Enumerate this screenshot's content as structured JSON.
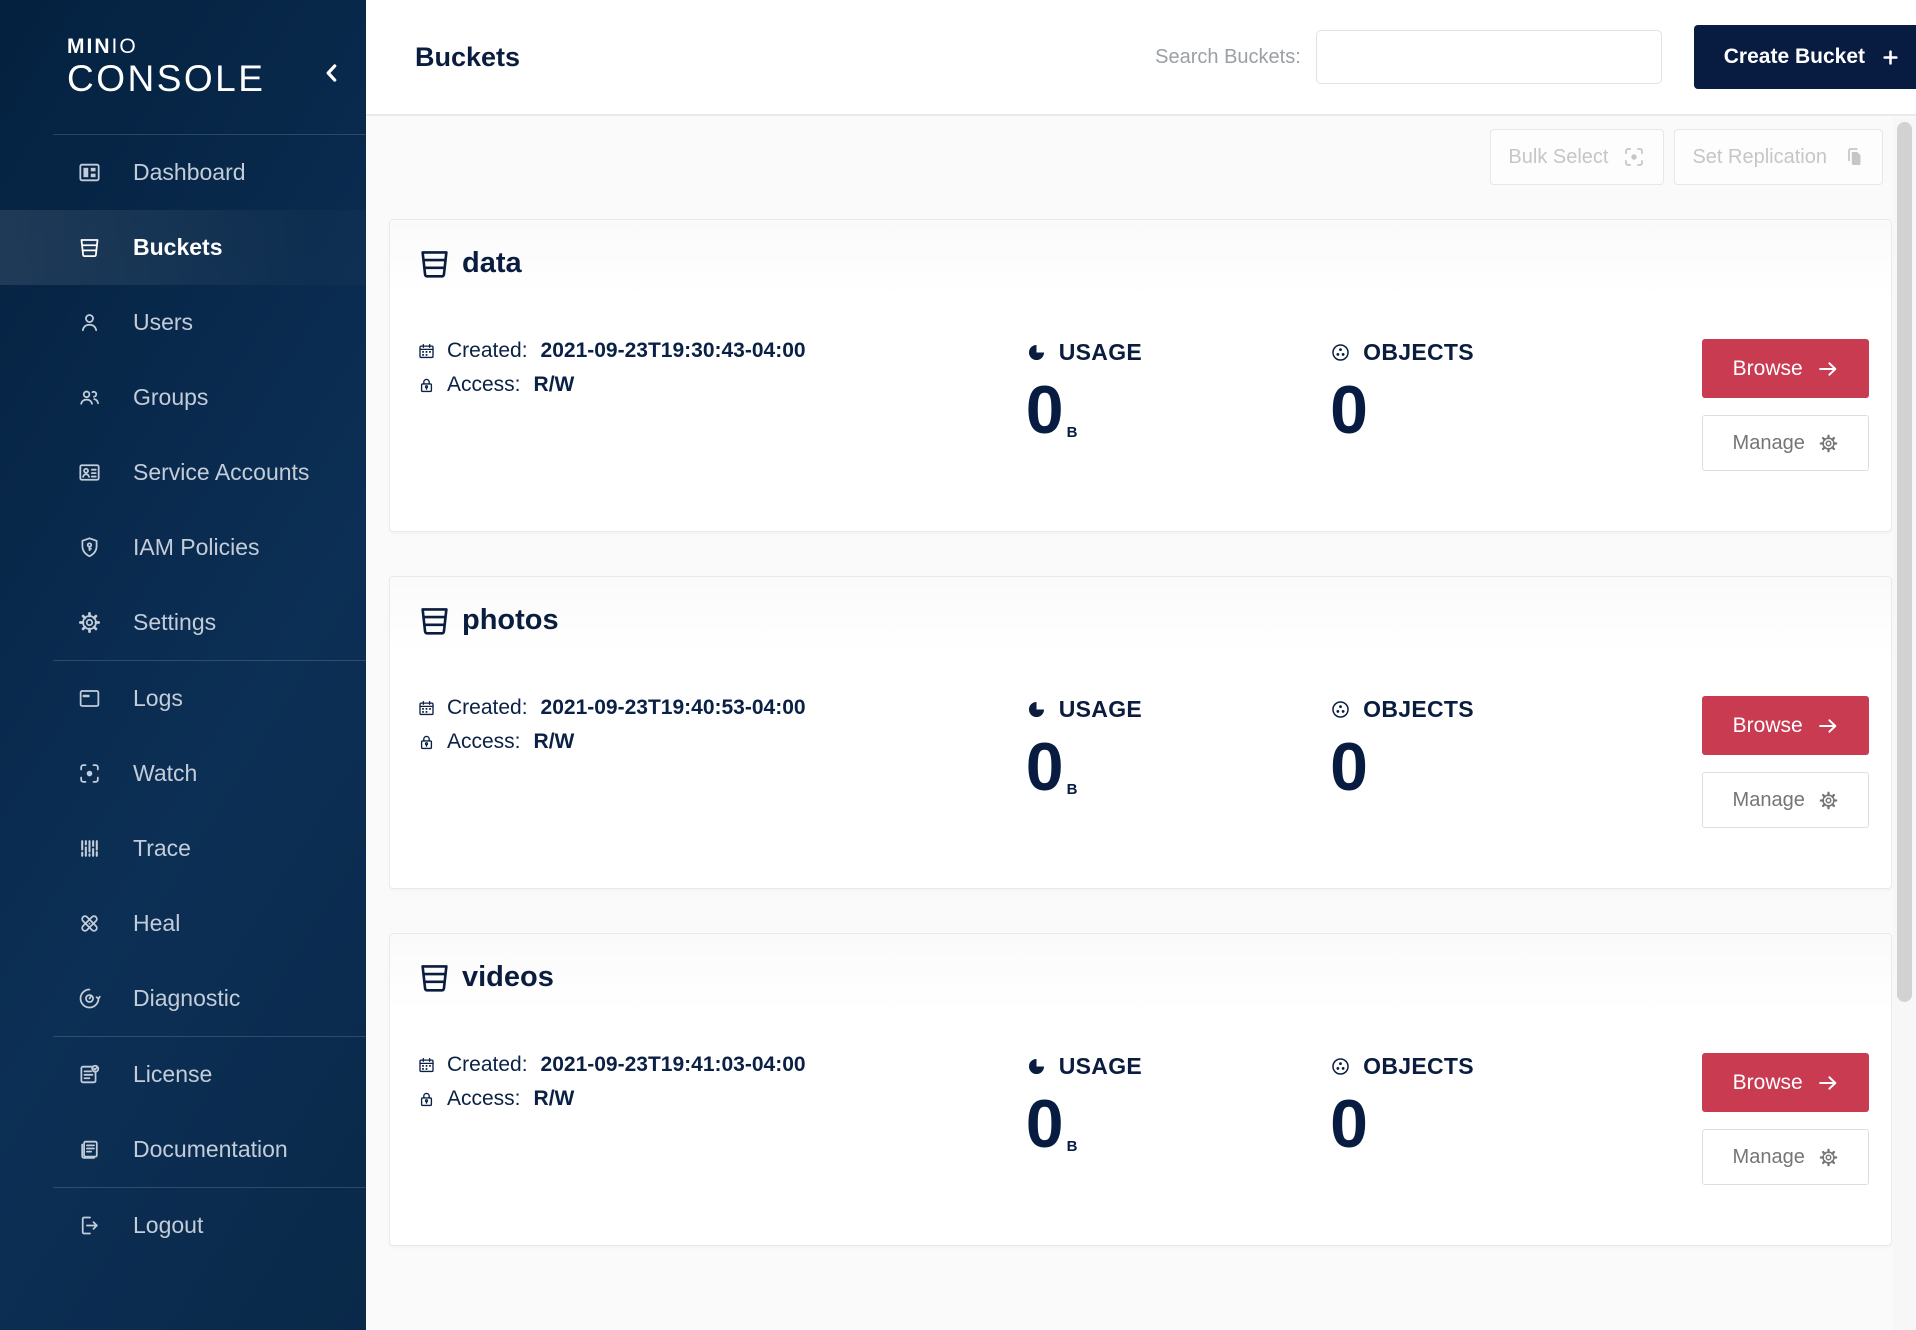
{
  "app": {
    "logo_bold": "MIN",
    "logo_light": "IO",
    "logo_line2": "CONSOLE"
  },
  "sidebar": {
    "collapse_icon": "chevron-left-icon",
    "items": [
      {
        "label": "Dashboard",
        "icon": "dashboard-icon",
        "active": false,
        "divider_before": true
      },
      {
        "label": "Buckets",
        "icon": "buckets-icon",
        "active": true,
        "divider_before": false
      },
      {
        "label": "Users",
        "icon": "users-icon",
        "active": false,
        "divider_before": false
      },
      {
        "label": "Groups",
        "icon": "groups-icon",
        "active": false,
        "divider_before": false
      },
      {
        "label": "Service Accounts",
        "icon": "service-accounts-icon",
        "active": false,
        "divider_before": false
      },
      {
        "label": "IAM Policies",
        "icon": "iam-policies-icon",
        "active": false,
        "divider_before": false
      },
      {
        "label": "Settings",
        "icon": "settings-icon",
        "active": false,
        "divider_before": false
      },
      {
        "label": "Logs",
        "icon": "logs-icon",
        "active": false,
        "divider_before": true
      },
      {
        "label": "Watch",
        "icon": "watch-icon",
        "active": false,
        "divider_before": false
      },
      {
        "label": "Trace",
        "icon": "trace-icon",
        "active": false,
        "divider_before": false
      },
      {
        "label": "Heal",
        "icon": "heal-icon",
        "active": false,
        "divider_before": false
      },
      {
        "label": "Diagnostic",
        "icon": "diagnostic-icon",
        "active": false,
        "divider_before": false
      },
      {
        "label": "License",
        "icon": "license-icon",
        "active": false,
        "divider_before": true
      },
      {
        "label": "Documentation",
        "icon": "documentation-icon",
        "active": false,
        "divider_before": false
      },
      {
        "label": "Logout",
        "icon": "logout-icon",
        "active": false,
        "divider_before": true
      }
    ]
  },
  "header": {
    "title": "Buckets",
    "search_label": "Search Buckets:",
    "search_value": "",
    "create_button": "Create Bucket"
  },
  "toolbar": {
    "bulk_select": "Bulk Select",
    "set_replication": "Set Replication"
  },
  "card_labels": {
    "created": "Created:",
    "access": "Access:",
    "usage": "USAGE",
    "objects": "OBJECTS",
    "browse": "Browse",
    "manage": "Manage"
  },
  "buckets": [
    {
      "name": "data",
      "created": "2021-09-23T19:30:43-04:00",
      "access": "R/W",
      "usage": "0",
      "usage_unit": "B",
      "objects": "0"
    },
    {
      "name": "photos",
      "created": "2021-09-23T19:40:53-04:00",
      "access": "R/W",
      "usage": "0",
      "usage_unit": "B",
      "objects": "0"
    },
    {
      "name": "videos",
      "created": "2021-09-23T19:41:03-04:00",
      "access": "R/W",
      "usage": "0",
      "usage_unit": "B",
      "objects": "0"
    }
  ],
  "colors": {
    "sidebar_navy": "#0A2B4F",
    "accent_navy": "#081C42",
    "accent_red": "#C83B51",
    "muted_text": "#9AA0A6",
    "disabled_text": "#C6C6C6"
  }
}
